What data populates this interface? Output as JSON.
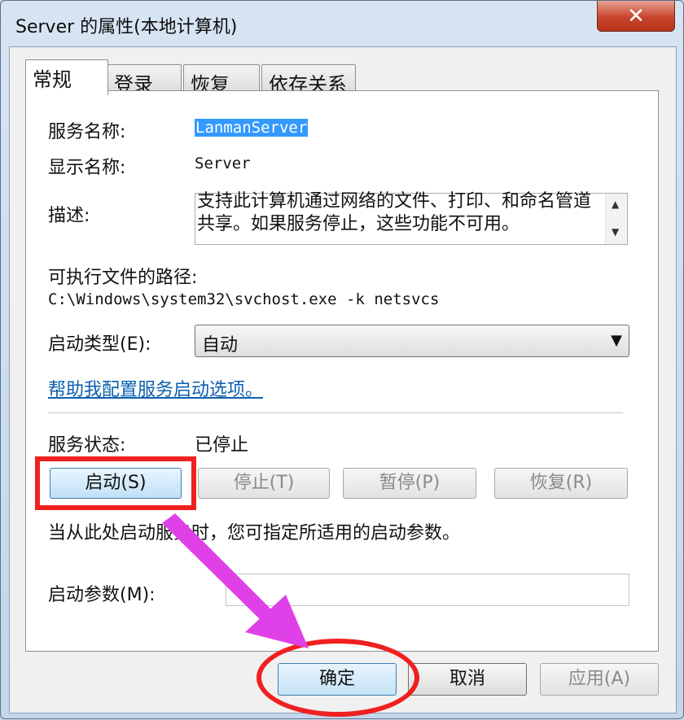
{
  "window": {
    "title": "Server 的属性(本地计算机)",
    "close_glyph": "✕"
  },
  "tabs": [
    {
      "label": "常规"
    },
    {
      "label": "登录"
    },
    {
      "label": "恢复"
    },
    {
      "label": "依存关系"
    }
  ],
  "general": {
    "service_name_label": "服务名称:",
    "service_name_value": "LanmanServer",
    "display_name_label": "显示名称:",
    "display_name_value": "Server",
    "description_label": "描述:",
    "description_value": "支持此计算机通过网络的文件、打印、和命名管道共享。如果服务停止，这些功能不可用。",
    "exe_path_label": "可执行文件的路径:",
    "exe_path_value": "C:\\Windows\\system32\\svchost.exe -k netsvcs",
    "startup_type_label": "启动类型(E):",
    "startup_type_value": "自动",
    "help_link": "帮助我配置服务启动选项。",
    "service_status_label": "服务状态:",
    "service_status_value": "已停止",
    "start_button": "启动(S)",
    "stop_button": "停止(T)",
    "pause_button": "暂停(P)",
    "resume_button": "恢复(R)",
    "start_params_hint": "当从此处启动服务时，您可指定所适用的启动参数。",
    "start_params_label": "启动参数(M):",
    "start_params_value": ""
  },
  "footer": {
    "ok_button": "确定",
    "cancel_button": "取消",
    "apply_button": "应用(A)"
  },
  "annotations": {
    "highlight_color": "#f02020",
    "arrow_color": "#e040e8"
  },
  "icons": {
    "dropdown": "chevron-down-icon",
    "scroll_up": "scroll-up-icon",
    "scroll_down": "scroll-down-icon"
  }
}
